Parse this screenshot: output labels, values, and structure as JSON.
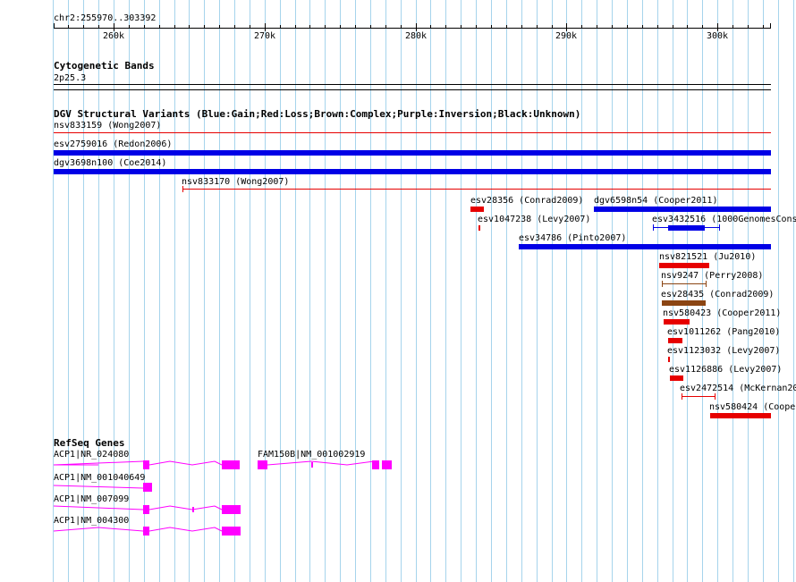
{
  "position": {
    "label": "chr2:255970..303392"
  },
  "ruler": {
    "ticks": [
      "260k",
      "270k",
      "280k",
      "290k",
      "300k"
    ]
  },
  "cytoband": {
    "title": "Cytogenetic Bands",
    "band": "2p25.3"
  },
  "dgv": {
    "title": "DGV Structural Variants (Blue:Gain;Red:Loss;Brown:Complex;Purple:Inversion;Black:Unknown)",
    "colors": {
      "gain": "#0000e6",
      "loss": "#e60000",
      "complex": "#8b4513",
      "loss_thin": "#e60000"
    },
    "variants": [
      {
        "label": "nsv833159 (Wong2007)"
      },
      {
        "label": "esv2759016 (Redon2006)"
      },
      {
        "label": "dgv3698n100 (Coe2014)"
      },
      {
        "label": "nsv833170 (Wong2007)"
      },
      {
        "label": "esv28356 (Conrad2009)"
      },
      {
        "label": "dgv6598n54 (Cooper2011)"
      },
      {
        "label": "esv1047238 (Levy2007)"
      },
      {
        "label": "esv3432516 (1000GenomesCons"
      },
      {
        "label": "esv34786 (Pinto2007)"
      },
      {
        "label": "nsv821521 (Ju2010)"
      },
      {
        "label": "nsv9247 (Perry2008)"
      },
      {
        "label": "esv28435 (Conrad2009)"
      },
      {
        "label": "nsv580423 (Cooper2011)"
      },
      {
        "label": "esv1011262 (Pang2010)"
      },
      {
        "label": "esv1123032 (Levy2007)"
      },
      {
        "label": "esv1126886 (Levy2007)"
      },
      {
        "label": "esv2472514 (McKernan20"
      },
      {
        "label": "nsv580424 (Coope"
      }
    ]
  },
  "refseq": {
    "title": "RefSeq Genes",
    "color": "#ff00ff",
    "genes": [
      {
        "label": "ACP1|NR_024080"
      },
      {
        "label": "FAM150B|NM_001002919"
      },
      {
        "label": "ACP1|NM_001040649"
      },
      {
        "label": "ACP1|NM_007099"
      },
      {
        "label": "ACP1|NM_004300"
      }
    ]
  }
}
